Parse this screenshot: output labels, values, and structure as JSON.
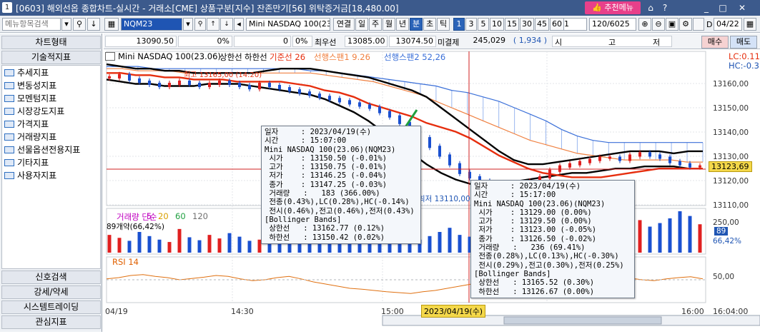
{
  "window": {
    "screen_no": "1",
    "title": "[0603] 해외선옵 종합차트-실시간 - 거래소[CME] 상품구분[지수] 잔존만기[56] 위탁증거금[18,480.00]",
    "recommend_menu": "추천메뉴",
    "icons": [
      "home-icon",
      "question-icon",
      "minimize-icon",
      "maximize-icon",
      "close-icon"
    ]
  },
  "toolbar": {
    "menu_search": "메뉴항목검색",
    "symbol_code": "NQM23",
    "symbol_name": "Mini NASDAQ 100(23.06)",
    "chart_type_buttons": [
      "연결",
      "일",
      "주",
      "월",
      "년",
      "분",
      "초",
      "틱"
    ],
    "active_period": "분",
    "interval_buttons": [
      "1",
      "3",
      "5",
      "10",
      "15",
      "30",
      "45",
      "60"
    ],
    "active_interval": "1",
    "interval_select": "1",
    "count": "120/6025",
    "date_label": "D",
    "date": "04/22"
  },
  "quote": {
    "price": "13090.50",
    "pct1": "0%",
    "change": "0",
    "pct2": "0%",
    "low_label": "최우선",
    "bid": "13085.00",
    "ask": "13074.50",
    "open_int_label": "미결제",
    "open_int": "245,029",
    "oi_change": "( 1,934 )",
    "market_summary": [
      "시",
      "고",
      "저"
    ],
    "sell_label": "매수",
    "buy_label": "매도"
  },
  "sidebar": {
    "chart_type_tab": "차트형태",
    "tech_tab": "기술적지표",
    "items": [
      "추세지표",
      "변동성지표",
      "모멘텀지표",
      "시장강도지표",
      "가격지표",
      "거래량지표",
      "선물옵션전용지표",
      "기타지표",
      "사용자지표"
    ],
    "bottom_tabs": [
      "신호검색",
      "강세/약세",
      "시스템트레이딩",
      "관심지표"
    ]
  },
  "chart_data": {
    "type": "line",
    "title": "Mini NASDAQ 100(23.06)",
    "legend": [
      {
        "name": "상한선",
        "color": "#000000"
      },
      {
        "name": "하한선",
        "color": "#000000"
      },
      {
        "name": "기준선 26",
        "color": "#e62e0e"
      },
      {
        "name": "선행스팬1 9.26",
        "color": "#f08040"
      },
      {
        "name": "선행스팬2 52,26",
        "color": "#3a6fd8"
      }
    ],
    "lc_label": "LC:0.11",
    "hc_label": "HC:-0.31",
    "y_ticks": [
      "13160,00",
      "13150,00",
      "13140,00",
      "13130,00",
      "13120,00",
      "13110,00"
    ],
    "ylim": [
      13105,
      13172
    ],
    "current_price": "13123,69",
    "x_ticks": [
      "04/19",
      "14:30",
      "15:00",
      "15:30",
      "16:00",
      "16:04:00"
    ],
    "crosshair_label": "2023/04/19(수)",
    "annotations": [
      "최고 13165,00 (14:20)",
      "최저 13110,00"
    ],
    "price_series": [
      13164,
      13165,
      13163,
      13162,
      13161,
      13160,
      13161,
      13162,
      13161,
      13160,
      13161,
      13162,
      13161,
      13160,
      13159,
      13161,
      13160,
      13159,
      13158,
      13157,
      13156,
      13155,
      13154,
      13153,
      13152,
      13151,
      13150,
      13148,
      13146,
      13143,
      13140,
      13136,
      13132,
      13128,
      13124,
      13120,
      13118,
      13116,
      13114,
      13113,
      13112,
      13114,
      13116,
      13118,
      13121,
      13123,
      13124,
      13125,
      13126,
      13127,
      13127,
      13126,
      13128,
      13129,
      13128,
      13127,
      13125,
      13124,
      13123,
      13123
    ],
    "upper_band": [
      13170,
      13169,
      13168,
      13168,
      13167,
      13167,
      13166,
      13166,
      13166,
      13166,
      13166,
      13167,
      13168,
      13168,
      13168,
      13167,
      13166,
      13165,
      13164,
      13162,
      13160,
      13158,
      13155,
      13150,
      13145,
      13140,
      13135,
      13130,
      13126,
      13124,
      13124,
      13125,
      13126,
      13127,
      13128,
      13129,
      13130,
      13130,
      13130,
      13129,
      13130,
      13130
    ],
    "lower_band": [
      13163,
      13162,
      13161,
      13161,
      13160,
      13160,
      13160,
      13161,
      13161,
      13161,
      13160,
      13159,
      13158,
      13157,
      13156,
      13154,
      13151,
      13148,
      13144,
      13139,
      13134,
      13129,
      13124,
      13120,
      13117,
      13115,
      13115,
      13115,
      13116,
      13117,
      13118,
      13119,
      13120,
      13120,
      13121,
      13122,
      13122,
      13123,
      13123,
      13123,
      13122,
      13122
    ],
    "base_line": [
      13166,
      13166,
      13165,
      13165,
      13164,
      13164,
      13163,
      13163,
      13163,
      13162,
      13162,
      13162,
      13162,
      13161,
      13160,
      13158,
      13157,
      13155,
      13152,
      13150,
      13148,
      13146,
      13143,
      13141,
      13139,
      13136,
      13132,
      13128,
      13125,
      13122,
      13120,
      13119,
      13118,
      13118,
      13118,
      13119,
      13120,
      13121,
      13122,
      13122,
      13122,
      13122
    ],
    "span_a": [
      13168,
      13168,
      13167,
      13167,
      13167,
      13166,
      13166,
      13166,
      13166,
      13166,
      13166,
      13166,
      13166,
      13166,
      13165,
      13164,
      13163,
      13162,
      13160,
      13158,
      13156,
      13153,
      13150,
      13147,
      13144,
      13141,
      13138,
      13135,
      13133,
      13131,
      13129,
      13128,
      13127,
      13126,
      13126,
      13126,
      13126,
      13125,
      13125
    ],
    "span_b": [
      13169,
      13169,
      13169,
      13168,
      13168,
      13168,
      13168,
      13168,
      13168,
      13168,
      13168,
      13168,
      13168,
      13167,
      13167,
      13166,
      13165,
      13164,
      13163,
      13162,
      13161,
      13160,
      13158,
      13157,
      13155,
      13153,
      13150,
      13147,
      13144,
      13140,
      13137,
      13135,
      13134,
      13134,
      13134,
      13134,
      13134,
      13134,
      13134
    ]
  },
  "volume_panel": {
    "label": "거래량 단순",
    "ma_values": [
      "5",
      "20",
      "60",
      "120"
    ],
    "ma_colors": [
      "#c000c0",
      "#d8a000",
      "#20a040",
      "#707070"
    ],
    "note": "89개약(66,42%)",
    "right_labels": [
      "250,00",
      "89",
      "66,42%"
    ],
    "bars": [
      30,
      25,
      20,
      35,
      28,
      22,
      18,
      40,
      26,
      21,
      30,
      24,
      33,
      27,
      20,
      22,
      19,
      25,
      30,
      28,
      35,
      40,
      55,
      60,
      70,
      62,
      45,
      38,
      50,
      30,
      26,
      22,
      28,
      35,
      42,
      30,
      27,
      33,
      40,
      36,
      45,
      38,
      50,
      44,
      48,
      42,
      55,
      40,
      38,
      52,
      46,
      60,
      48,
      55,
      44,
      50,
      58,
      70,
      62,
      48
    ]
  },
  "rsi_panel": {
    "label": "RSI 14",
    "right_label": "50,00",
    "values": [
      52,
      55,
      60,
      62,
      58,
      55,
      50,
      53,
      56,
      60,
      58,
      52,
      48,
      50,
      55,
      58,
      52,
      45,
      40,
      35,
      30,
      28,
      25,
      22,
      20,
      18,
      22,
      25,
      30,
      35,
      40,
      45,
      50,
      55,
      52,
      48,
      53,
      58,
      55,
      50,
      52,
      55,
      58,
      54,
      50,
      48,
      52,
      55,
      57,
      52
    ]
  },
  "tooltip1": {
    "lines": [
      "일자     : 2023/04/19(수)",
      "시간     : 15:07:00",
      "Mini NASDAQ 100(23.06)(NQM23)",
      " 시가    : 13150.50 (-0.01%)",
      " 고가    : 13150.75 (-0.01%)",
      " 저가    : 13146.25 (-0.04%)",
      " 종가    : 13147.25 (-0.03%)",
      " 거래량   :   183 (366.00%)",
      " 전종(0.43%),LC(0.28%),HC(-0.14%)",
      " 전시(0.46%),전고(0.46%),전저(0.43%)",
      "[Bollinger Bands]",
      " 상한선   : 13162.77 (0.12%)",
      " 하한선   : 13150.42 (0.02%)"
    ]
  },
  "tooltip2": {
    "lines": [
      "일자     : 2023/04/19(수)",
      "시간     : 15:17:00",
      "Mini NASDAQ 100(23.06)(NQM23)",
      " 시가    : 13129.00 (0.00%)",
      " 고가    : 13129.50 (0.00%)",
      " 저가    : 13123.00 (-0.05%)",
      " 종가    : 13126.50 (-0.02%)",
      " 거래량   :   236 (69.41%)",
      " 전종(0.28%),LC(0.13%),HC(-0.30%)",
      " 전시(0.29%),전고(0.30%),전저(0.25%)",
      "[Bollinger Bands]",
      " 상한선   : 13165.52 (0.30%)",
      " 하한선   : 13126.67 (0.00%)"
    ]
  }
}
